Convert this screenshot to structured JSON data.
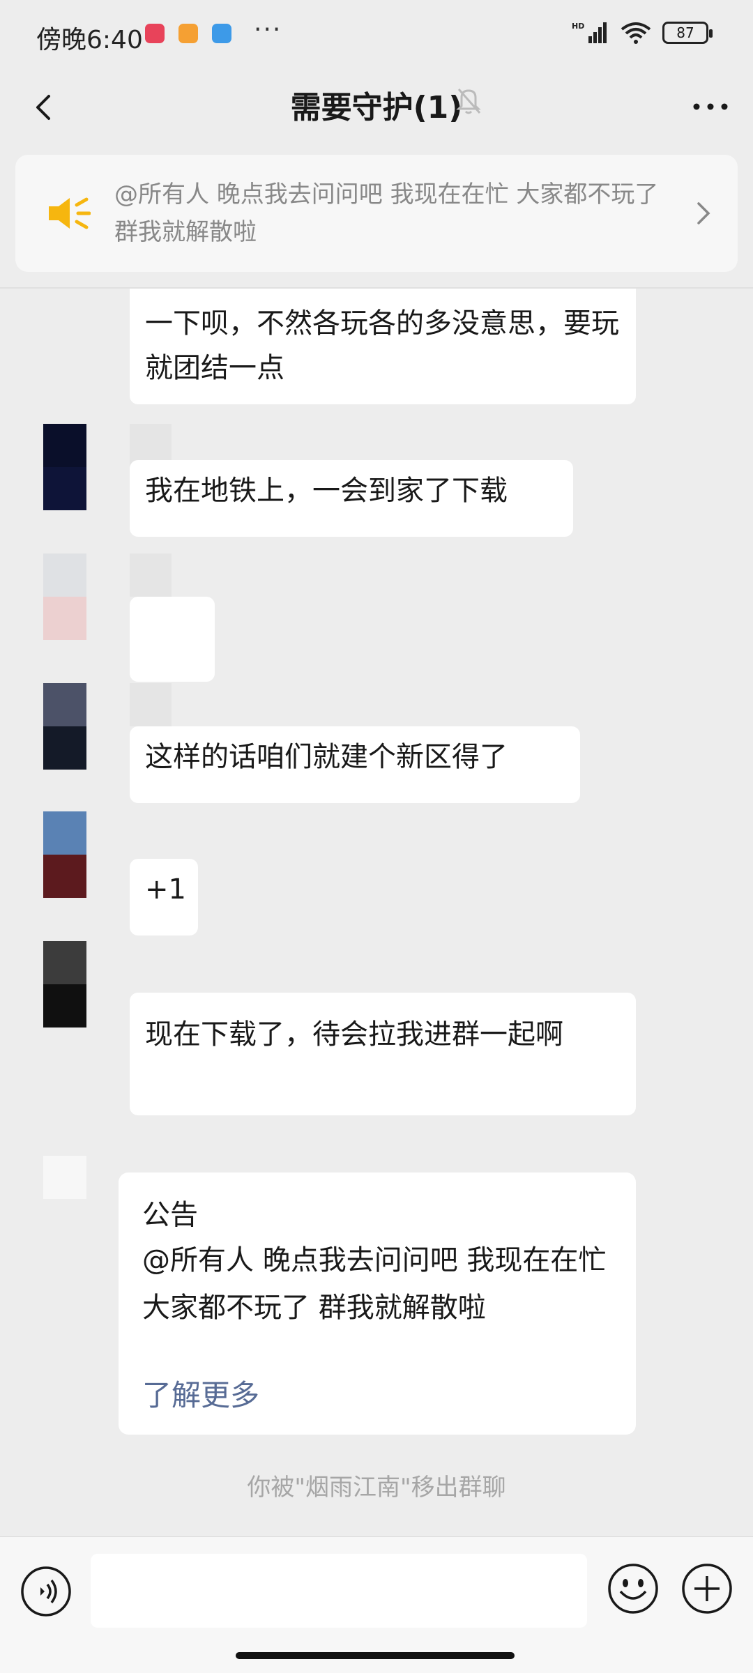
{
  "status_bar": {
    "time": "傍晚6:40",
    "more": "···",
    "battery": "87",
    "network": "HD"
  },
  "nav": {
    "title": "需要守护(1)",
    "back_icon": "chevron-left-icon",
    "mute_icon": "bell-off-icon",
    "more_icon": "more-horizontal-icon"
  },
  "notice_banner": {
    "text": "@所有人 晚点我去问问吧 我现在在忙 大家都不玩了 群我就解散啦",
    "icon": "megaphone-icon",
    "arrow_icon": "chevron-right-icon"
  },
  "messages": [
    {
      "text": "一下呗，不然各玩各的多没意思，要玩就团结一点"
    },
    {
      "text": "我在地铁上，一会到家了下载"
    },
    {
      "text": ""
    },
    {
      "text": "这样的话咱们就建个新区得了"
    },
    {
      "text": "+1"
    },
    {
      "text": "现在下载了，待会拉我进群一起啊"
    }
  ],
  "notice_card": {
    "title": "公告",
    "body": "@所有人 晚点我去问问吧 我现在在忙 大家都不玩了 群我就解散啦",
    "link": "了解更多"
  },
  "system_message": "你被\"烟雨江南\"移出群聊",
  "input_bar": {
    "voice_icon": "voice-icon",
    "emoji_icon": "emoji-icon",
    "plus_icon": "plus-circle-icon",
    "placeholder": ""
  },
  "colors": {
    "background": "#ededed",
    "bubble": "#ffffff",
    "link": "#576b95",
    "notice_icon": "#f6b60f"
  }
}
